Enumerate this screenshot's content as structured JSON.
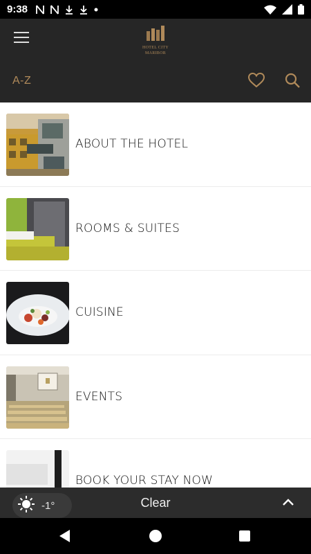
{
  "status_bar": {
    "time": "9:38",
    "left_icons": [
      "netflix-icon",
      "netflix-icon",
      "download-icon",
      "download-icon",
      "dot-icon"
    ],
    "right_icons": [
      "wifi-icon",
      "signal-icon",
      "battery-icon"
    ]
  },
  "header": {
    "logo_text_line1": "HOTEL CITY",
    "logo_text_line2": "MARIBOR",
    "az_label": "A-Z",
    "icons": [
      "menu-icon",
      "heart-icon",
      "search-icon"
    ],
    "accent_color": "#b08a5a",
    "background_color": "#262626"
  },
  "list": {
    "items": [
      {
        "label": "ABOUT THE HOTEL",
        "image": "hotel-building-photo"
      },
      {
        "label": "ROOMS & SUITES",
        "image": "hotel-room-photo"
      },
      {
        "label": "CUISINE",
        "image": "dish-photo"
      },
      {
        "label": "EVENTS",
        "image": "conference-room-photo"
      },
      {
        "label": "BOOK YOUR STAY NOW",
        "image": "window-view-photo"
      }
    ]
  },
  "weather": {
    "temperature": "-1°",
    "condition": "Clear",
    "icon": "sun-icon"
  },
  "nav_bar": {
    "icons": [
      "back-icon",
      "home-icon",
      "recents-icon"
    ]
  }
}
